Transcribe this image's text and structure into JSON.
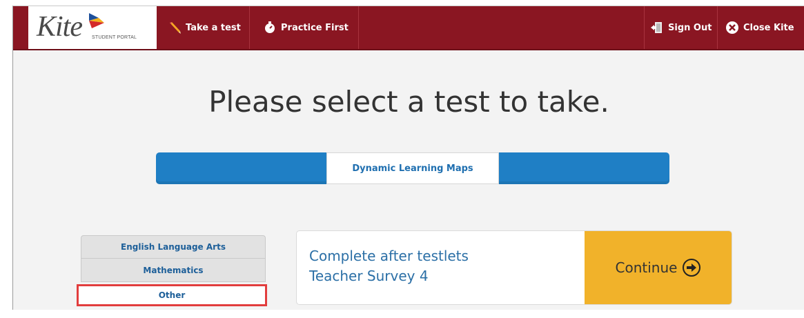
{
  "app": {
    "logo_text": "Kite",
    "logo_subtitle": "STUDENT PORTAL"
  },
  "nav": {
    "take_test": "Take a test",
    "practice_first": "Practice First",
    "sign_out": "Sign Out",
    "close_kite": "Close Kite"
  },
  "page": {
    "title": "Please select a test to take."
  },
  "program_tab": {
    "label": "Dynamic Learning Maps"
  },
  "subjects": {
    "ela": "English Language Arts",
    "math": "Mathematics",
    "other": "Other"
  },
  "test": {
    "line1": "Complete after testlets",
    "line2": "Teacher Survey 4",
    "continue_label": "Continue"
  },
  "colors": {
    "header_bg": "#8a1622",
    "program_bar": "#1f7fc5",
    "continue_bg": "#f1b22a",
    "selected_outline": "#e23d3d",
    "link_blue": "#2b6fa6"
  },
  "icons": {
    "take_test": "pencil-icon",
    "practice_first": "stopwatch-icon",
    "sign_out": "door-exit-icon",
    "close_kite": "close-circle-icon",
    "continue": "arrow-right-circle-icon"
  }
}
